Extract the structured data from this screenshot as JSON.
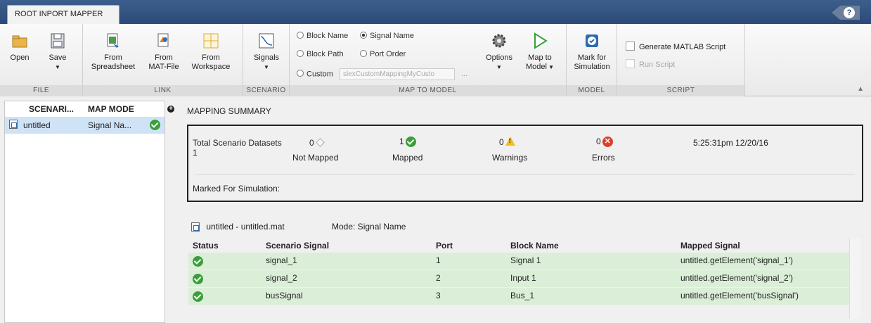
{
  "app": {
    "tab_title": "ROOT INPORT MAPPER",
    "help": "?"
  },
  "ribbon": {
    "file": {
      "label": "FILE",
      "open": "Open",
      "save": "Save"
    },
    "link": {
      "label": "LINK",
      "from_spreadsheet_1": "From",
      "from_spreadsheet_2": "Spreadsheet",
      "from_matfile_1": "From",
      "from_matfile_2": "MAT-File",
      "from_workspace_1": "From",
      "from_workspace_2": "Workspace"
    },
    "scenario": {
      "label": "SCENARIO",
      "signals": "Signals"
    },
    "map_to_model": {
      "label": "MAP TO MODEL",
      "block_name": "Block Name",
      "signal_name": "Signal Name",
      "block_path": "Block Path",
      "port_order": "Port Order",
      "custom": "Custom",
      "custom_value": "slexCustomMappingMyCusto",
      "ellipsis": "...",
      "options": "Options",
      "map_to_model_1": "Map to",
      "map_to_model_2": "Model"
    },
    "model": {
      "label": "MODEL",
      "mark_1": "Mark for",
      "mark_2": "Simulation"
    },
    "script": {
      "label": "SCRIPT",
      "generate": "Generate MATLAB Script",
      "run": "Run Script"
    }
  },
  "left": {
    "col_scenario": "SCENARI...",
    "col_mapmode": "MAP MODE",
    "rows": [
      {
        "name": "untitled",
        "mode": "Signal Na..."
      }
    ]
  },
  "summary": {
    "title": "MAPPING SUMMARY",
    "total_label": "Total Scenario Datasets",
    "total_value": "1",
    "not_mapped_count": "0",
    "not_mapped_label": "Not Mapped",
    "mapped_count": "1",
    "mapped_label": "Mapped",
    "warnings_count": "0",
    "warnings_label": "Warnings",
    "errors_count": "0",
    "errors_label": "Errors",
    "timestamp": "5:25:31pm 12/20/16",
    "marked_label": "Marked For Simulation:"
  },
  "detail": {
    "file": "untitled - untitled.mat",
    "mode": "Mode: Signal Name",
    "headers": {
      "status": "Status",
      "scenario_signal": "Scenario Signal",
      "port": "Port",
      "block_name": "Block Name",
      "mapped_signal": "Mapped Signal"
    },
    "rows": [
      {
        "signal": "signal_1",
        "port": "1",
        "block": "Signal 1",
        "mapped": "untitled.getElement('signal_1')"
      },
      {
        "signal": "signal_2",
        "port": "2",
        "block": "Input 1",
        "mapped": "untitled.getElement('signal_2')"
      },
      {
        "signal": "busSignal",
        "port": "3",
        "block": "Bus_1",
        "mapped": "untitled.getElement('busSignal')"
      }
    ]
  }
}
